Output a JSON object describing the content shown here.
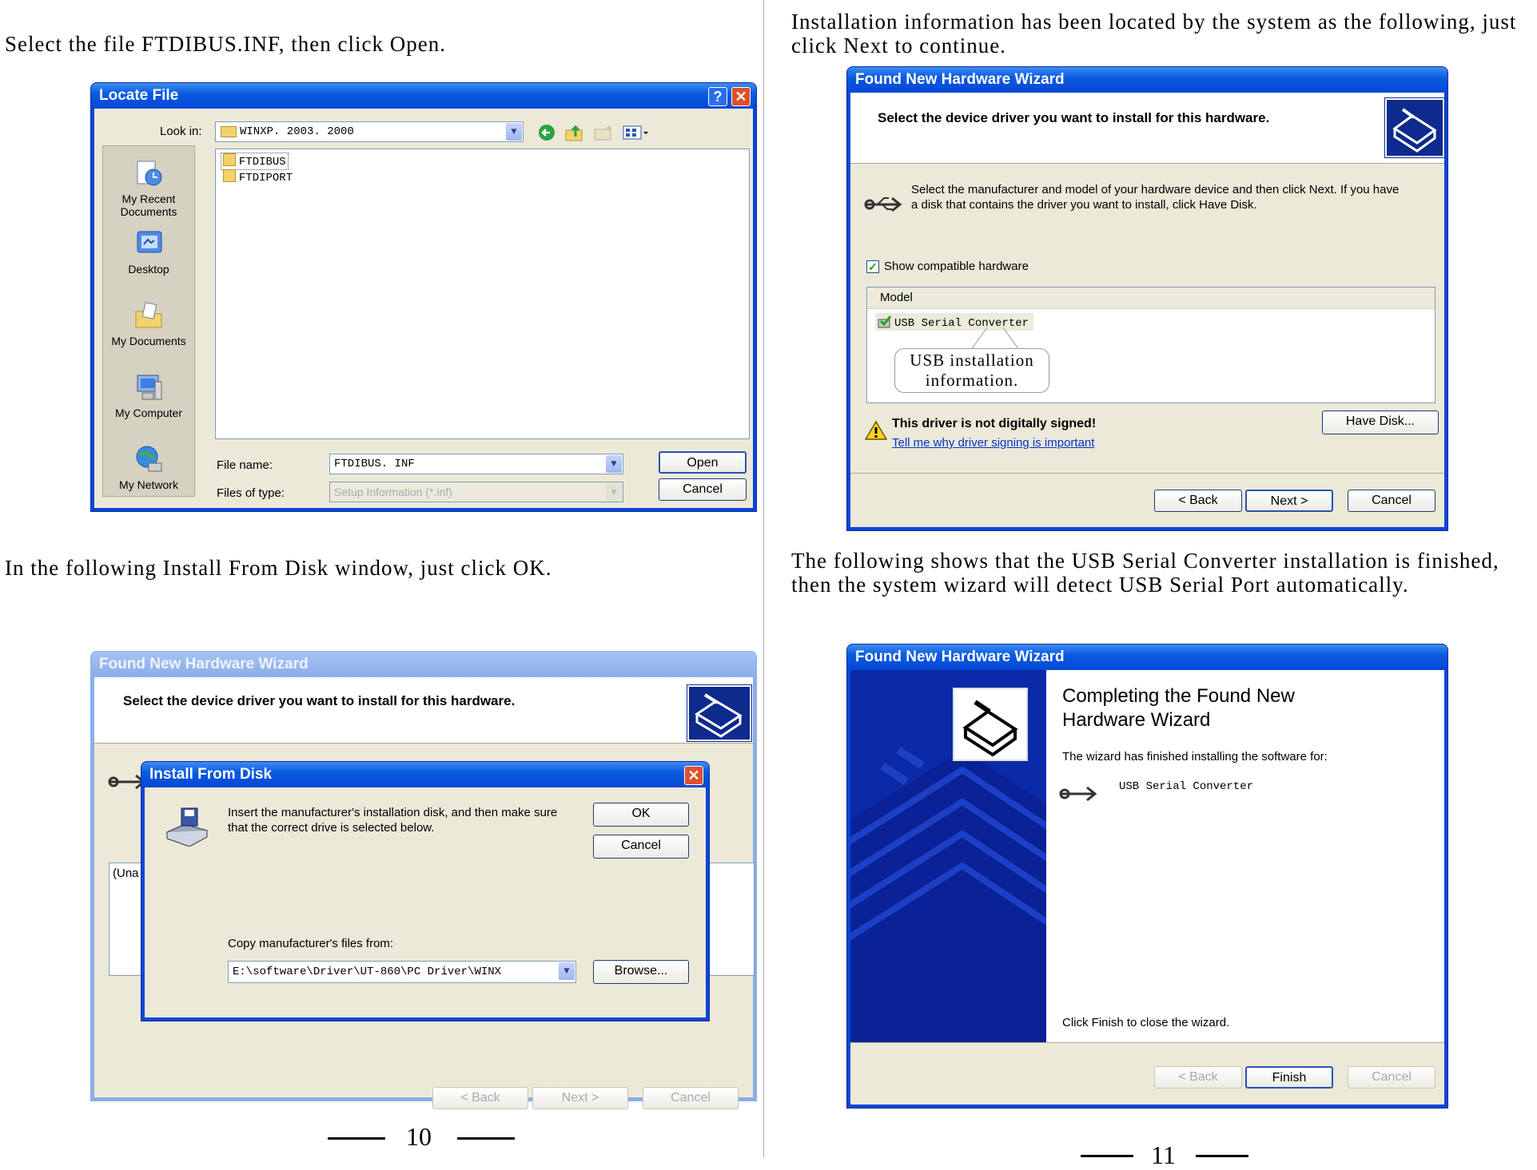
{
  "captions": {
    "top_left": "Select the file FTDIBUS.INF, then click Open.",
    "bottom_left": "In the following Install From Disk window, just click OK.",
    "top_right_1": "Installation information has been located by the system as the following, just",
    "top_right_2": "click Next to continue.",
    "bottom_right_1": "The following shows that the USB Serial Converter installation is finished,",
    "bottom_right_2": "then the system wizard will detect USB Serial Port automatically."
  },
  "page_numbers": {
    "left": "10",
    "right": "11"
  },
  "locate_file": {
    "title": "Locate File",
    "help_btn": "?",
    "close_btn": "✕",
    "look_in_label": "Look in:",
    "look_in_value": "WINXP. 2003. 2000",
    "places": [
      "My Recent Documents",
      "Desktop",
      "My Documents",
      "My Computer",
      "My Network"
    ],
    "files": [
      "FTDIBUS",
      "FTDIPORT"
    ],
    "file_name_label": "File name:",
    "file_name_value": "FTDIBUS. INF",
    "file_type_label": "Files of type:",
    "file_type_value": "Setup Information (*.inf)",
    "open_btn": "Open",
    "cancel_btn": "Cancel"
  },
  "wizard_select": {
    "title": "Found New Hardware Wizard",
    "header": "Select the device driver you want to install for this hardware.",
    "instructions": "Select the manufacturer and model of your hardware device and then click Next. If you have a disk that contains the driver you want to install, click Have Disk.",
    "show_compatible": "Show compatible hardware",
    "model_header": "Model",
    "model_item": "USB Serial Converter",
    "callout": "USB installation information.",
    "warning": "This driver is not digitally signed!",
    "link": "Tell me why driver signing is important",
    "have_disk_btn": "Have Disk...",
    "back_btn": "< Back",
    "next_btn": "Next >",
    "cancel_btn": "Cancel"
  },
  "wizard_bg": {
    "title": "Found New Hardware Wizard",
    "header": "Select the device driver you want to install for this hardware.",
    "list_fragment": "(Una",
    "back_btn": "< Back",
    "next_btn": "Next >",
    "cancel_btn": "Cancel"
  },
  "install_from_disk": {
    "title": "Install From Disk",
    "close_btn": "✕",
    "message": "Insert the manufacturer's installation disk, and then make sure that the correct drive is selected below.",
    "ok_btn": "OK",
    "cancel_btn": "Cancel",
    "copy_label": "Copy manufacturer's files from:",
    "path_value": "E:\\software\\Driver\\UT-860\\PC Driver\\WINX",
    "browse_btn": "Browse..."
  },
  "wizard_complete": {
    "title": "Found New Hardware Wizard",
    "heading": "Completing the Found New Hardware Wizard",
    "finished_text": "The wizard has finished installing the software for:",
    "device": "USB Serial Converter",
    "close_text": "Click Finish to close the wizard.",
    "back_btn": "< Back",
    "finish_btn": "Finish",
    "cancel_btn": "Cancel"
  }
}
